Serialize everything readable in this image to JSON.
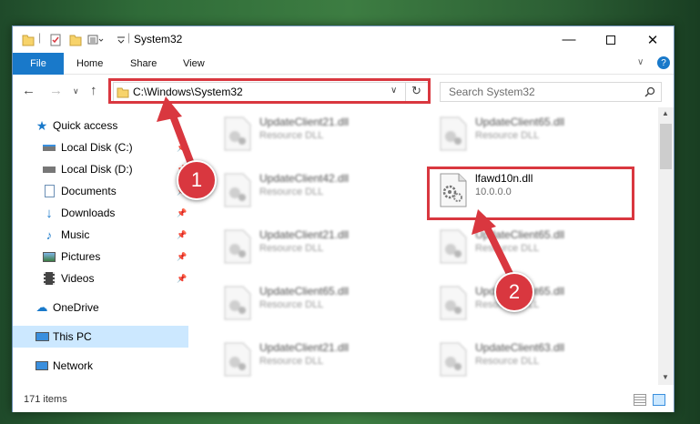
{
  "titlebar": {
    "title": "System32"
  },
  "ribbon": {
    "tabs": [
      "File",
      "Home",
      "Share",
      "View"
    ]
  },
  "address": {
    "path": "C:\\Windows\\System32",
    "search_placeholder": "Search System32"
  },
  "nav": {
    "items": [
      {
        "label": "Quick access",
        "icon": "star-icon"
      },
      {
        "label": "Local Disk (C:)",
        "icon": "drive-icon"
      },
      {
        "label": "Local Disk (D:)",
        "icon": "drive-icon"
      },
      {
        "label": "Documents",
        "icon": "documents-icon"
      },
      {
        "label": "Downloads",
        "icon": "download-icon"
      },
      {
        "label": "Music",
        "icon": "music-icon"
      },
      {
        "label": "Pictures",
        "icon": "pictures-icon"
      },
      {
        "label": "Videos",
        "icon": "videos-icon"
      },
      {
        "label": "OneDrive",
        "icon": "cloud-icon"
      },
      {
        "label": "This PC",
        "icon": "computer-icon"
      },
      {
        "label": "Network",
        "icon": "network-icon"
      }
    ]
  },
  "files": {
    "left": [
      {
        "name": "UpdateClient21.dll",
        "type": "Resource DLL"
      },
      {
        "name": "UpdateClient42.dll",
        "type": "Resource DLL"
      },
      {
        "name": "UpdateClient21.dll",
        "type": "Resource DLL"
      },
      {
        "name": "UpdateClient65.dll",
        "type": "Resource DLL"
      },
      {
        "name": "UpdateClient21.dll",
        "type": "Resource DLL"
      }
    ],
    "right": [
      {
        "name": "UpdateClient65.dll",
        "type": "Resource DLL"
      },
      {
        "name": "lfawd10n.dll",
        "type": "10.0.0.0"
      },
      {
        "name": "UpdateClient65.dll",
        "type": "Resource DLL"
      },
      {
        "name": "UpdateClient65.dll",
        "type": "Resource DLL"
      },
      {
        "name": "UpdateClient63.dll",
        "type": "Resource DLL"
      }
    ]
  },
  "status": {
    "item_count": "171 items"
  },
  "annotations": {
    "step1": "1",
    "step2": "2",
    "color": "#d9373f"
  }
}
